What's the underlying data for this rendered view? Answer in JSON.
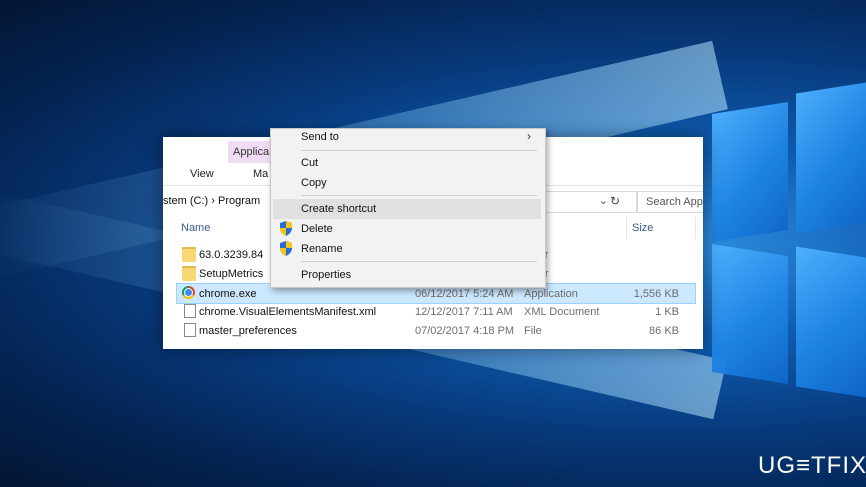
{
  "explorer": {
    "contextual_tab_group": "Applica",
    "tabs": {
      "view": "View",
      "manage": "Ma"
    },
    "address": {
      "path": "stem (C:)  ›  Program",
      "search_placeholder": "Search Appl"
    },
    "columns": {
      "name": "Name",
      "type": "e",
      "size": "Size"
    },
    "rows": [
      {
        "name": "63.0.3239.84",
        "date": "",
        "type": "older",
        "size": "",
        "icon": "folder-icon"
      },
      {
        "name": "SetupMetrics",
        "date": "",
        "type": "older",
        "size": "",
        "icon": "folder-icon"
      },
      {
        "name": "chrome.exe",
        "date": "06/12/2017 5:24 AM",
        "type": "Application",
        "size": "1,556 KB",
        "icon": "chrome-icon",
        "selected": true
      },
      {
        "name": "chrome.VisualElementsManifest.xml",
        "date": "12/12/2017 7:11 AM",
        "type": "XML Document",
        "size": "1 KB",
        "icon": "xml-document-icon"
      },
      {
        "name": "master_preferences",
        "date": "07/02/2017 4:18 PM",
        "type": "File",
        "size": "86 KB",
        "icon": "file-icon"
      }
    ]
  },
  "context_menu": {
    "items": [
      {
        "label": "Send to",
        "submenu": true
      },
      {
        "label": "Cut"
      },
      {
        "label": "Copy"
      },
      {
        "label": "Create shortcut",
        "highlighted": true
      },
      {
        "label": "Delete",
        "icon": "uac-shield-icon"
      },
      {
        "label": "Rename",
        "icon": "uac-shield-icon"
      },
      {
        "label": "Properties"
      }
    ]
  },
  "watermark": "UG≡TFIX",
  "colors": {
    "selection": "#cce8ff",
    "contextual_tab": "#f1dcf6",
    "desktop": "#0f5cb0"
  }
}
